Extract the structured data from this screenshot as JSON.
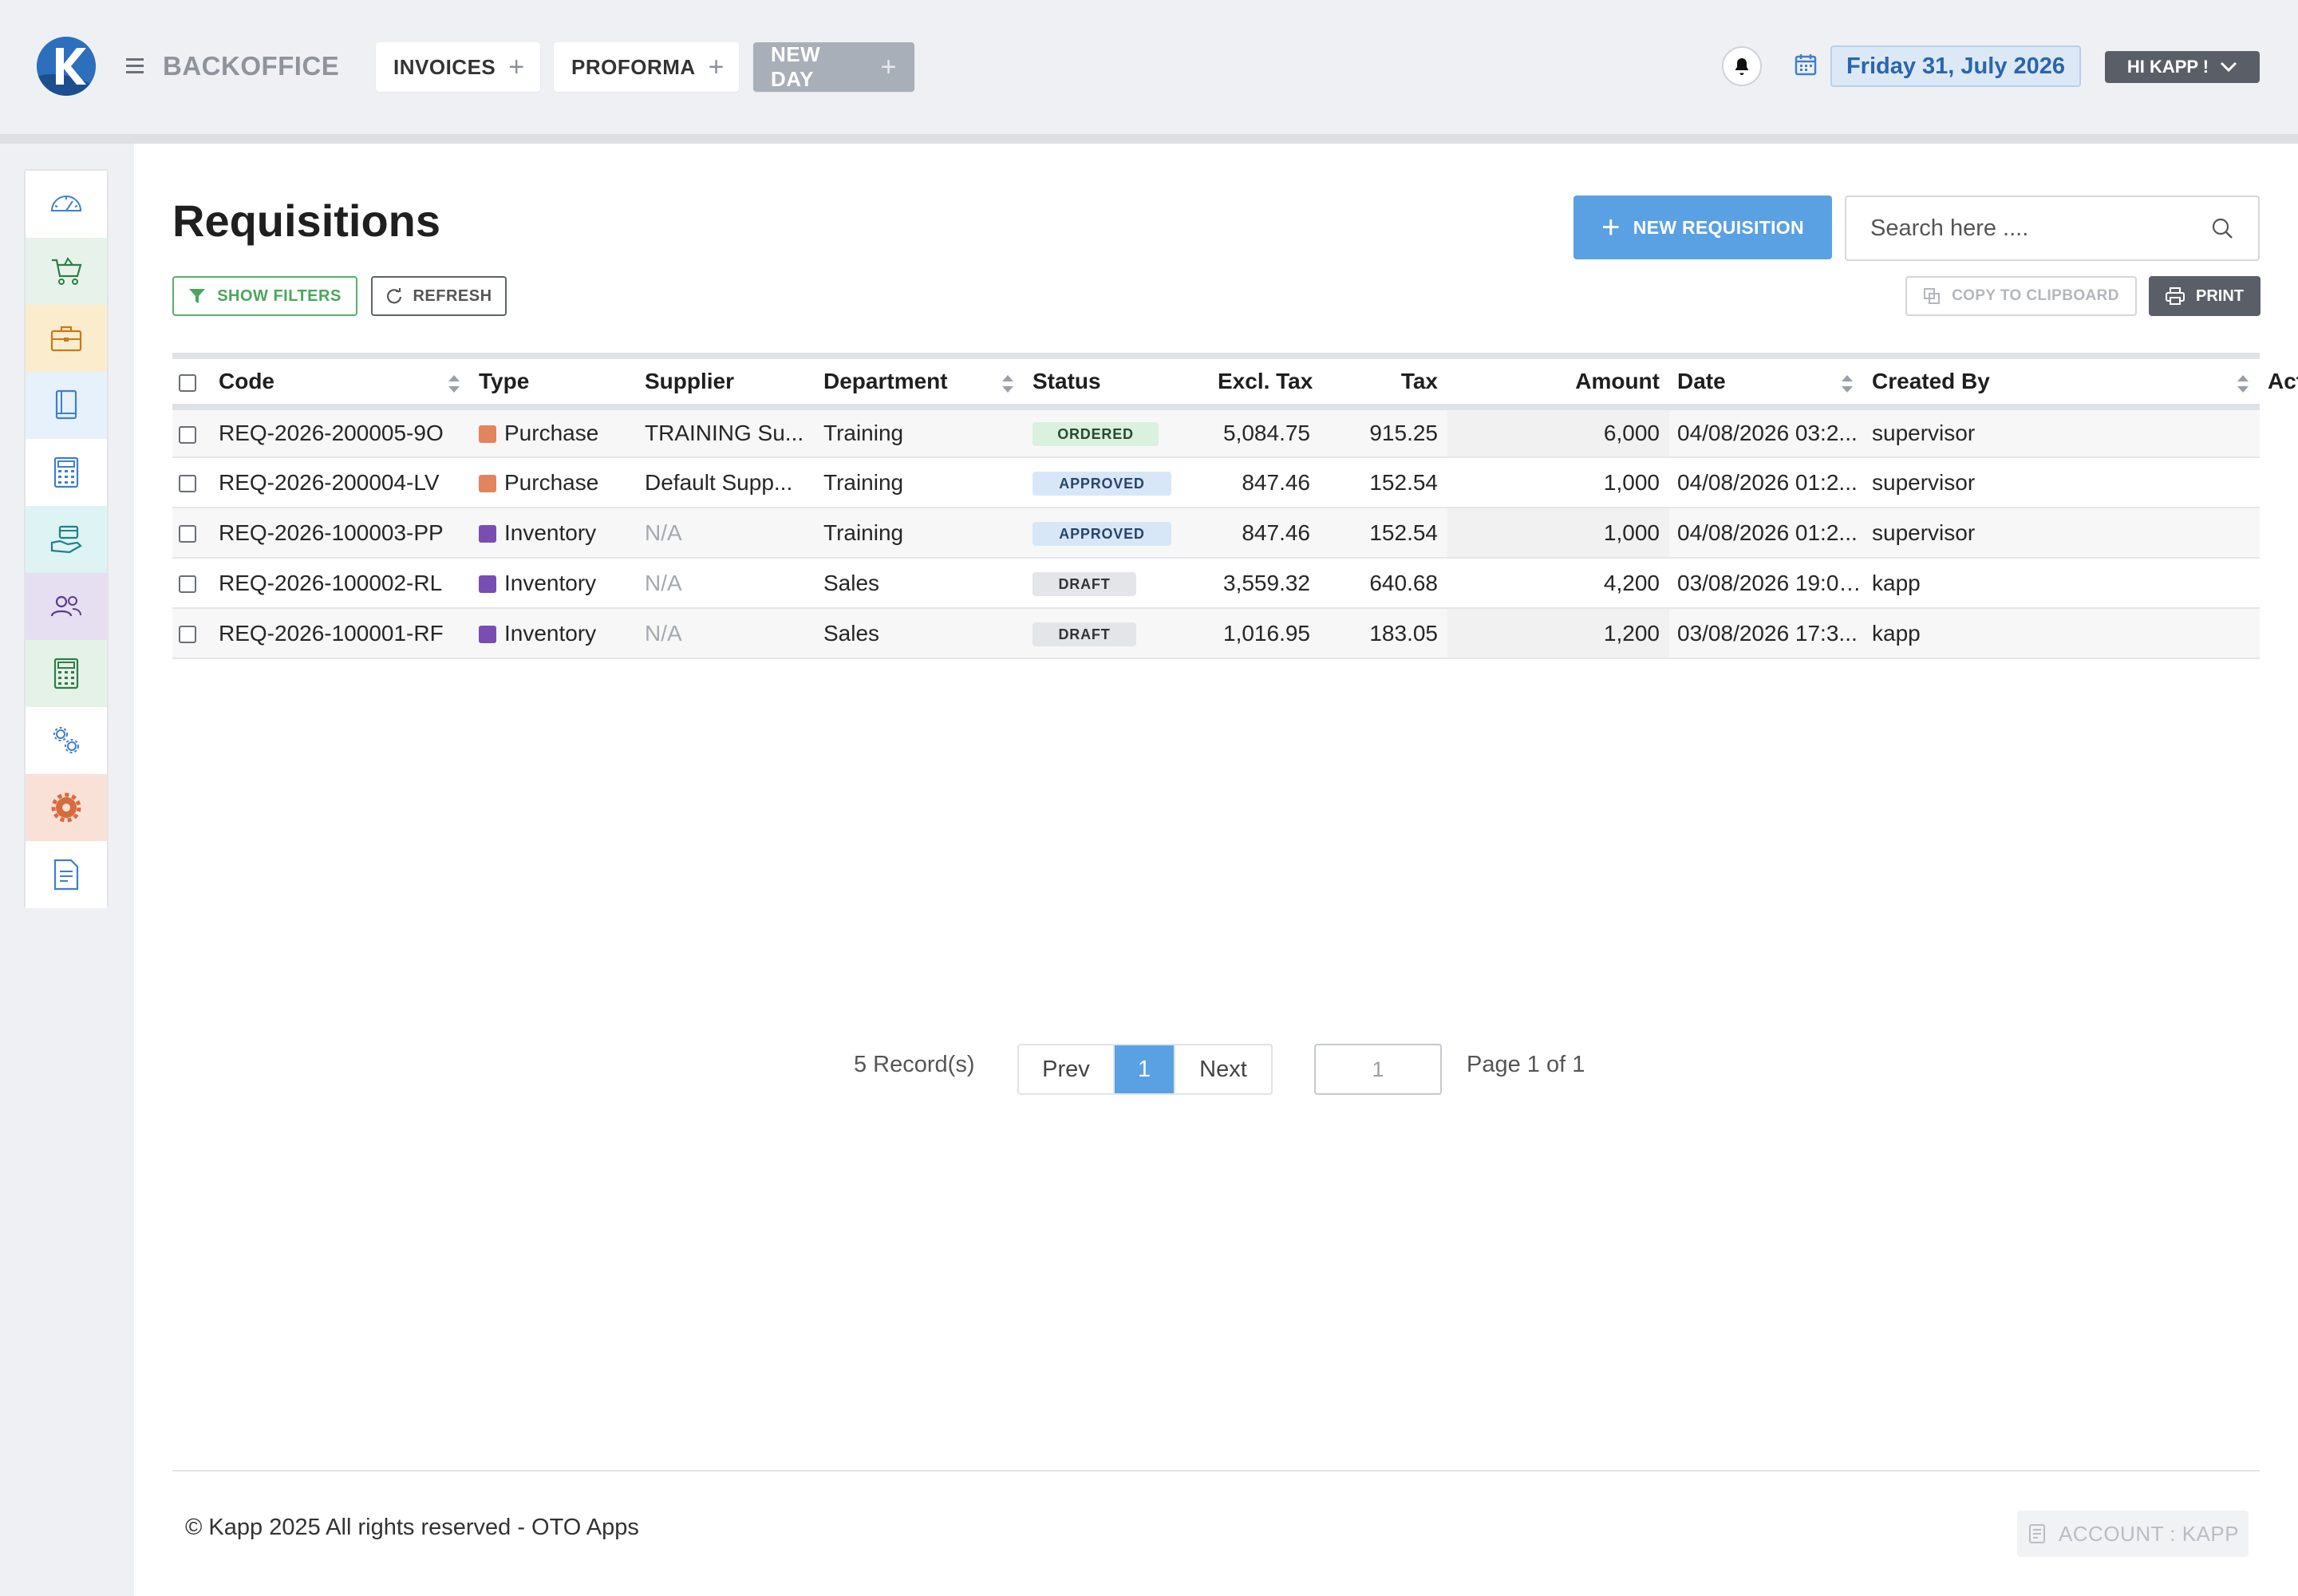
{
  "app": {
    "brand": "BACKOFFICE",
    "tabs": [
      {
        "label": "INVOICES"
      },
      {
        "label": "PROFORMA"
      },
      {
        "label": "NEW DAY"
      }
    ],
    "date": "Friday 31, July 2026",
    "user_greeting": "HI KAPP !"
  },
  "sidebar": {
    "items": [
      {
        "icon": "dashboard-gauge-icon",
        "bg": "#ffffff"
      },
      {
        "icon": "cart-icon",
        "bg": "#e7f3ea"
      },
      {
        "icon": "briefcase-icon",
        "bg": "#fbeccd"
      },
      {
        "icon": "book-icon",
        "bg": "#e7f1fb"
      },
      {
        "icon": "calculator-icon",
        "bg": "#ffffff"
      },
      {
        "icon": "hand-card-icon",
        "bg": "#ddf3f4"
      },
      {
        "icon": "users-icon",
        "bg": "#e6dff1"
      },
      {
        "icon": "accounting-calculator-icon",
        "bg": "#e5f2e8"
      },
      {
        "icon": "settings-gears-icon",
        "bg": "#ffffff"
      },
      {
        "icon": "cog-icon",
        "bg": "#f9e1d8"
      },
      {
        "icon": "document-icon",
        "bg": "#ffffff"
      }
    ]
  },
  "page": {
    "title": "Requisitions",
    "new_button": "NEW REQUISITION",
    "search_placeholder": "Search here ....",
    "show_filters": "SHOW FILTERS",
    "refresh": "REFRESH",
    "copy": "COPY TO CLIPBOARD",
    "print": "PRINT"
  },
  "table": {
    "headers": {
      "code": "Code",
      "type": "Type",
      "supplier": "Supplier",
      "department": "Department",
      "status": "Status",
      "excl_tax": "Excl. Tax",
      "tax": "Tax",
      "amount": "Amount",
      "date": "Date",
      "created_by": "Created By",
      "action": "Action"
    },
    "rows": [
      {
        "code": "REQ-2026-200005-9O",
        "type": "Purchase",
        "type_color": "#e2845c",
        "supplier": "TRAINING Su...",
        "supplier_muted": false,
        "department": "Training",
        "status": "ORDERED",
        "excl_tax": "5,084.75",
        "tax": "915.25",
        "amount": "6,000",
        "date": "04/08/2026 03:2...",
        "created_by": "supervisor"
      },
      {
        "code": "REQ-2026-200004-LV",
        "type": "Purchase",
        "type_color": "#e2845c",
        "supplier": "Default Supp...",
        "supplier_muted": false,
        "department": "Training",
        "status": "APPROVED",
        "excl_tax": "847.46",
        "tax": "152.54",
        "amount": "1,000",
        "date": "04/08/2026 01:2...",
        "created_by": "supervisor"
      },
      {
        "code": "REQ-2026-100003-PP",
        "type": "Inventory",
        "type_color": "#7a4db3",
        "supplier": "N/A",
        "supplier_muted": true,
        "department": "Training",
        "status": "APPROVED",
        "excl_tax": "847.46",
        "tax": "152.54",
        "amount": "1,000",
        "date": "04/08/2026 01:2...",
        "created_by": "supervisor"
      },
      {
        "code": "REQ-2026-100002-RL",
        "type": "Inventory",
        "type_color": "#7a4db3",
        "supplier": "N/A",
        "supplier_muted": true,
        "department": "Sales",
        "status": "DRAFT",
        "excl_tax": "3,559.32",
        "tax": "640.68",
        "amount": "4,200",
        "date": "03/08/2026 19:01...",
        "created_by": "kapp"
      },
      {
        "code": "REQ-2026-100001-RF",
        "type": "Inventory",
        "type_color": "#7a4db3",
        "supplier": "N/A",
        "supplier_muted": true,
        "department": "Sales",
        "status": "DRAFT",
        "excl_tax": "1,016.95",
        "tax": "183.05",
        "amount": "1,200",
        "date": "03/08/2026 17:3...",
        "created_by": "kapp"
      }
    ]
  },
  "pagination": {
    "records": "5 Record(s)",
    "prev": "Prev",
    "current": "1",
    "next": "Next",
    "page_input": "1",
    "page_of": "Page 1 of 1"
  },
  "footer": {
    "copyright": "© Kapp 2025 All rights reserved - OTO Apps",
    "account": "ACCOUNT : KAPP"
  }
}
